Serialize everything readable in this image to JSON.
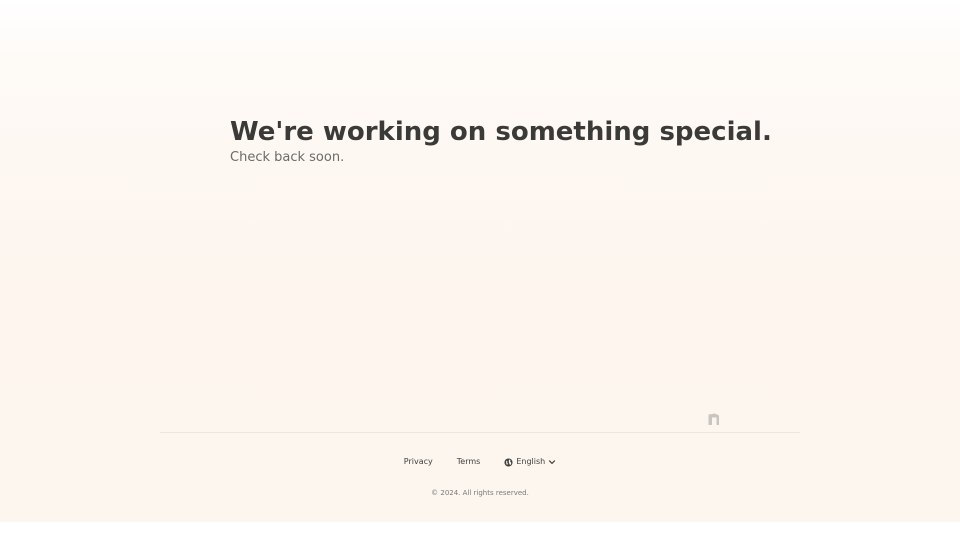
{
  "hero": {
    "title": "We're working on something special.",
    "subtitle": "Check back soon."
  },
  "footer": {
    "links": [
      "Privacy",
      "Terms"
    ],
    "language": {
      "selected": "English",
      "icon": "globe-icon",
      "chevron": "chevron-down-icon"
    },
    "copyright": "© 2024. All rights reserved."
  },
  "brand": {
    "icon": "notion-style-logo-icon",
    "color": "#c9c6c2"
  },
  "colors": {
    "background": "#fdf6ef",
    "title": "#3a3a38",
    "subtitle": "#6b6b68"
  }
}
